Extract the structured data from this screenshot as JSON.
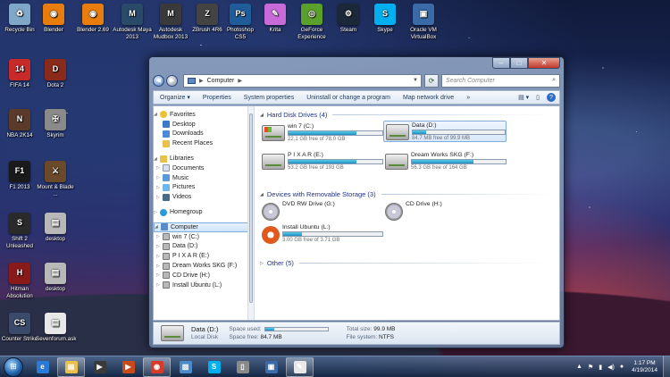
{
  "colors": {
    "accent": "#1c8fc6",
    "window_frame": "#8fa3c2",
    "group_header": "#1e3287"
  },
  "desktop_icons": [
    {
      "label": "Recycle Bin",
      "icon": "recycle-bin-icon",
      "color": "#7fa7c8",
      "glyph": "♻"
    },
    {
      "label": "Blender",
      "icon": "blender-icon",
      "color": "#e87d0d",
      "glyph": "◉"
    },
    {
      "label": "Blender 2.69",
      "icon": "blender-icon",
      "color": "#e87d0d",
      "glyph": "◉"
    },
    {
      "label": "Autodesk Maya 2013",
      "icon": "maya-icon",
      "color": "#2a4a6a",
      "glyph": "M"
    },
    {
      "label": "Autodesk Mudbox 2013",
      "icon": "mudbox-icon",
      "color": "#3a3a3a",
      "glyph": "M"
    },
    {
      "label": "ZBrush 4R6",
      "icon": "zbrush-icon",
      "color": "#444444",
      "glyph": "Z"
    },
    {
      "label": "Photoshop CS5",
      "icon": "photoshop-icon",
      "color": "#1f5d9a",
      "glyph": "Ps"
    },
    {
      "label": "Krita",
      "icon": "krita-icon",
      "color": "#c86ad8",
      "glyph": "✎"
    },
    {
      "label": "GeForce Experience",
      "icon": "geforce-icon",
      "color": "#5aa02a",
      "glyph": "◎"
    },
    {
      "label": "Steam",
      "icon": "steam-icon",
      "color": "#1b2838",
      "glyph": "⚙"
    },
    {
      "label": "Skype",
      "icon": "skype-icon",
      "color": "#00aff0",
      "glyph": "S"
    },
    {
      "label": "Oracle VM VirtualBox",
      "icon": "virtualbox-icon",
      "color": "#3a6aa8",
      "glyph": "▣"
    },
    {
      "label": "FIFA 14",
      "icon": "fifa-icon",
      "color": "#c82a2a",
      "glyph": "14"
    },
    {
      "label": "Dota 2",
      "icon": "dota-icon",
      "color": "#8a2a1a",
      "glyph": "D"
    },
    {
      "label": "NBA 2K14",
      "icon": "nba-icon",
      "color": "#5a3a2a",
      "glyph": "N"
    },
    {
      "label": "Skyrim",
      "icon": "skyrim-icon",
      "color": "#8a8a8a",
      "glyph": "✠"
    },
    {
      "label": "F1 2013",
      "icon": "f1-icon",
      "color": "#1a1a1a",
      "glyph": "F1"
    },
    {
      "label": "Mount & Blade ...",
      "icon": "mount-blade-icon",
      "color": "#6a4a2a",
      "glyph": "⚔"
    },
    {
      "label": "Shift 2 Unleashed",
      "icon": "shift2-icon",
      "color": "#2a2a2a",
      "glyph": "S"
    },
    {
      "label": "desktop",
      "icon": "desktop-file-icon",
      "color": "#b8b8b8",
      "glyph": "▤"
    },
    {
      "label": "Hitman Absolution",
      "icon": "hitman-icon",
      "color": "#8a1a1a",
      "glyph": "H"
    },
    {
      "label": "desktop",
      "icon": "desktop-file-icon",
      "color": "#b8b8b8",
      "glyph": "▤"
    },
    {
      "label": "Counter Strike",
      "icon": "counter-strike-icon",
      "color": "#3a4a6a",
      "glyph": "CS"
    },
    {
      "label": "Sevenforum.ask",
      "icon": "text-file-icon",
      "color": "#e8e8e8",
      "glyph": "▤"
    }
  ],
  "window": {
    "address": "Computer",
    "search_placeholder": "Search Computer",
    "toolbar": {
      "organize": "Organize ▾",
      "properties": "Properties",
      "system_properties": "System properties",
      "uninstall": "Uninstall or change a program",
      "map_drive": "Map network drive",
      "more": "»"
    },
    "nav": {
      "favorites": "Favorites",
      "desktop": "Desktop",
      "downloads": "Downloads",
      "recent": "Recent Places",
      "libraries": "Libraries",
      "documents": "Documents",
      "music": "Music",
      "pictures": "Pictures",
      "videos": "Videos",
      "homegroup": "Homegroup",
      "computer": "Computer",
      "drives": [
        "win 7 (C:)",
        "Data (D:)",
        "P I X A R (E:)",
        "Dream Works SKG (F:)",
        "CD Drive (H:)",
        "Install Ubuntu (L:)"
      ]
    },
    "groups": {
      "hdd": "Hard Disk Drives (4)",
      "removable": "Devices with Removable Storage (3)",
      "other": "Other (5)"
    },
    "hdd": [
      {
        "name": "win 7 (C:)",
        "free": "22.1 GB free of 78.0 GB",
        "used_pct": 72
      },
      {
        "name": "Data (D:)",
        "free": "84.7 MB free of 99.9 MB",
        "used_pct": 15
      },
      {
        "name": "P I X A R (E:)",
        "free": "53.2 GB free of 193 GB",
        "used_pct": 72
      },
      {
        "name": "Dream Works SKG (F:)",
        "free": "56.3 GB free of 164 GB",
        "used_pct": 66
      }
    ],
    "removable": [
      {
        "name": "DVD RW Drive (G:)"
      },
      {
        "name": "CD Drive (H:)"
      },
      {
        "name": "Install Ubuntu (L:)",
        "free": "3.00 GB free of 3.71 GB",
        "used_pct": 19
      }
    ],
    "details": {
      "name": "Data (D:)",
      "type": "Local Disk",
      "space_used_label": "Space used:",
      "space_free_label": "Space free:",
      "space_free": "84.7 MB",
      "total_label": "Total size:",
      "total": "99.9 MB",
      "fs_label": "File system:",
      "fs": "NTFS",
      "used_pct": 15
    }
  },
  "taskbar": {
    "apps": [
      {
        "icon": "ie-icon",
        "color": "#2a7ad8",
        "glyph": "e",
        "active": false
      },
      {
        "icon": "explorer-icon",
        "color": "#e8c04a",
        "glyph": "▤",
        "active": true
      },
      {
        "icon": "media-player-icon",
        "color": "#3a3a3a",
        "glyph": "▶",
        "active": false
      },
      {
        "icon": "media-center-icon",
        "color": "#c84a1a",
        "glyph": "▶",
        "active": false
      },
      {
        "icon": "chrome-icon",
        "color": "#d83a2a",
        "glyph": "◉",
        "active": true
      },
      {
        "icon": "photo-viewer-icon",
        "color": "#4a8ac8",
        "glyph": "▧",
        "active": false
      },
      {
        "icon": "skype-icon",
        "color": "#00aff0",
        "glyph": "S",
        "active": false
      },
      {
        "icon": "phone-icon",
        "color": "#8a8a8a",
        "glyph": "▯",
        "active": false
      },
      {
        "icon": "network-icon",
        "color": "#3a6aa8",
        "glyph": "▣",
        "active": false
      },
      {
        "icon": "paint-icon",
        "color": "#e8e8e8",
        "glyph": "✎",
        "active": true
      }
    ],
    "time": "1:17 PM",
    "date": "4/19/2014"
  }
}
